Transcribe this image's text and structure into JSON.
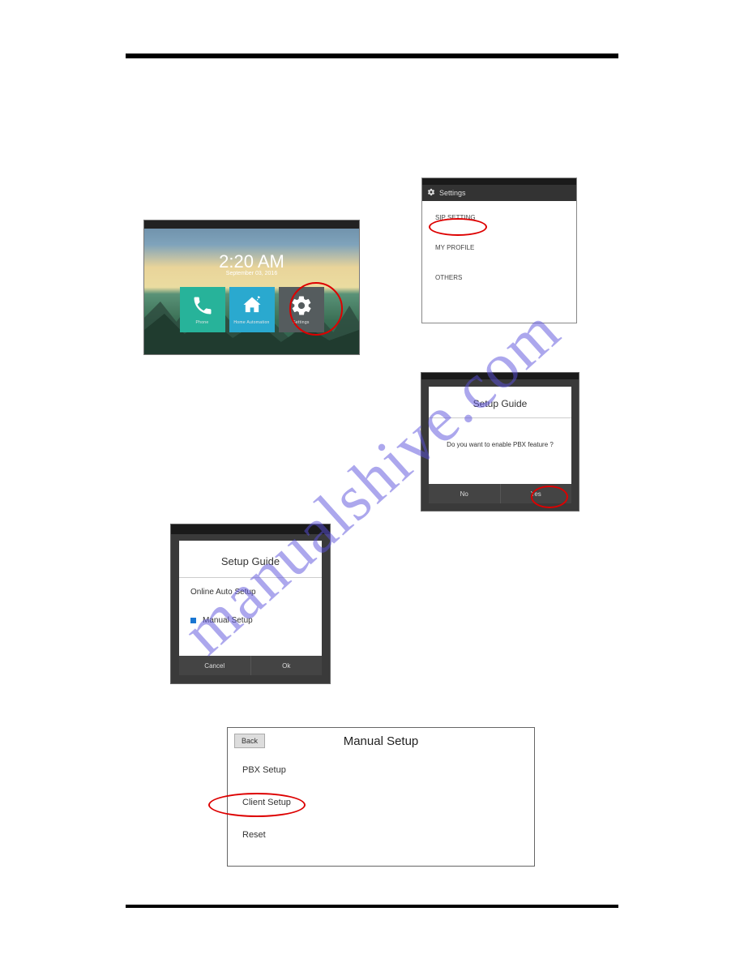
{
  "watermark": "manualshive.com",
  "figA": {
    "time": "2:20 AM",
    "date": "September 03, 2016",
    "tiles": {
      "phone": "Phone",
      "home": "Home Automation",
      "settings": "Settings"
    }
  },
  "figB": {
    "header": "Settings",
    "items": [
      "SIP SETTING",
      "MY PROFILE",
      "OTHERS"
    ]
  },
  "figC": {
    "title": "Setup Guide",
    "body": "Do you want to enable PBX feature ?",
    "btn_no": "No",
    "btn_yes": "Yes"
  },
  "figD": {
    "title": "Setup Guide",
    "opt_online": "Online Auto Setup",
    "opt_manual": "Manual Setup",
    "btn_cancel": "Cancel",
    "btn_ok": "Ok"
  },
  "figE": {
    "back": "Back",
    "title": "Manual Setup",
    "items": [
      "PBX Setup",
      "Client Setup",
      "Reset"
    ]
  }
}
